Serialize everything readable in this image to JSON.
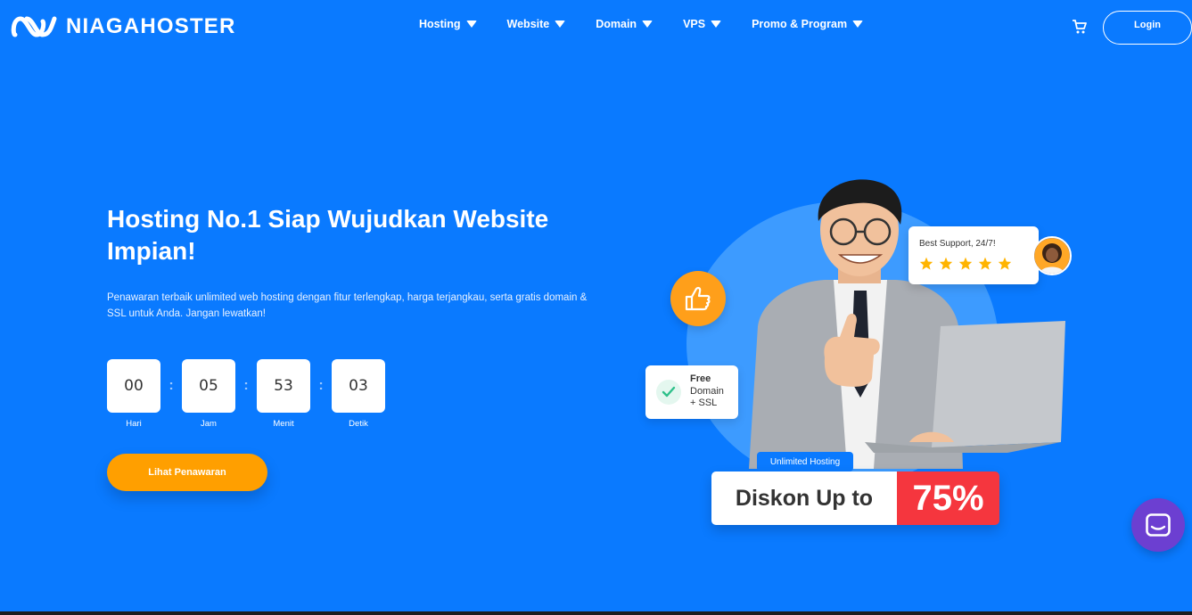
{
  "brand": {
    "name": "NIAGAHOSTER",
    "primary_color": "#0a7aff",
    "accent_color": "#ff9f00"
  },
  "nav": {
    "items": [
      {
        "label": "Hosting"
      },
      {
        "label": "Website"
      },
      {
        "label": "Domain"
      },
      {
        "label": "VPS"
      },
      {
        "label": "Promo & Program"
      }
    ],
    "cart_icon": "cart-icon",
    "login_label": "Login"
  },
  "hero": {
    "title": "Hosting No.1 Siap Wujudkan Website Impian!",
    "subtitle": "Penawaran terbaik unlimited web hosting dengan fitur terlengkap, harga terjangkau, serta gratis domain & SSL untuk Anda. Jangan lewatkan!",
    "countdown": [
      {
        "value": "00",
        "label": "Hari"
      },
      {
        "value": "05",
        "label": "Jam"
      },
      {
        "value": "53",
        "label": "Menit"
      },
      {
        "value": "03",
        "label": "Detik"
      }
    ],
    "cta_label": "Lihat Penawaran"
  },
  "illustration": {
    "support_title": "Best Support, 24/7!",
    "rating_stars": 5,
    "ssl_line1": "Free",
    "ssl_line2": "Domain",
    "ssl_line3": "+ SSL",
    "unlimited_tag": "Unlimited Hosting",
    "discount_text": "Diskon Up to",
    "discount_value": "75%"
  },
  "chat": {
    "icon": "chat-icon",
    "color": "#6c3fd1"
  }
}
